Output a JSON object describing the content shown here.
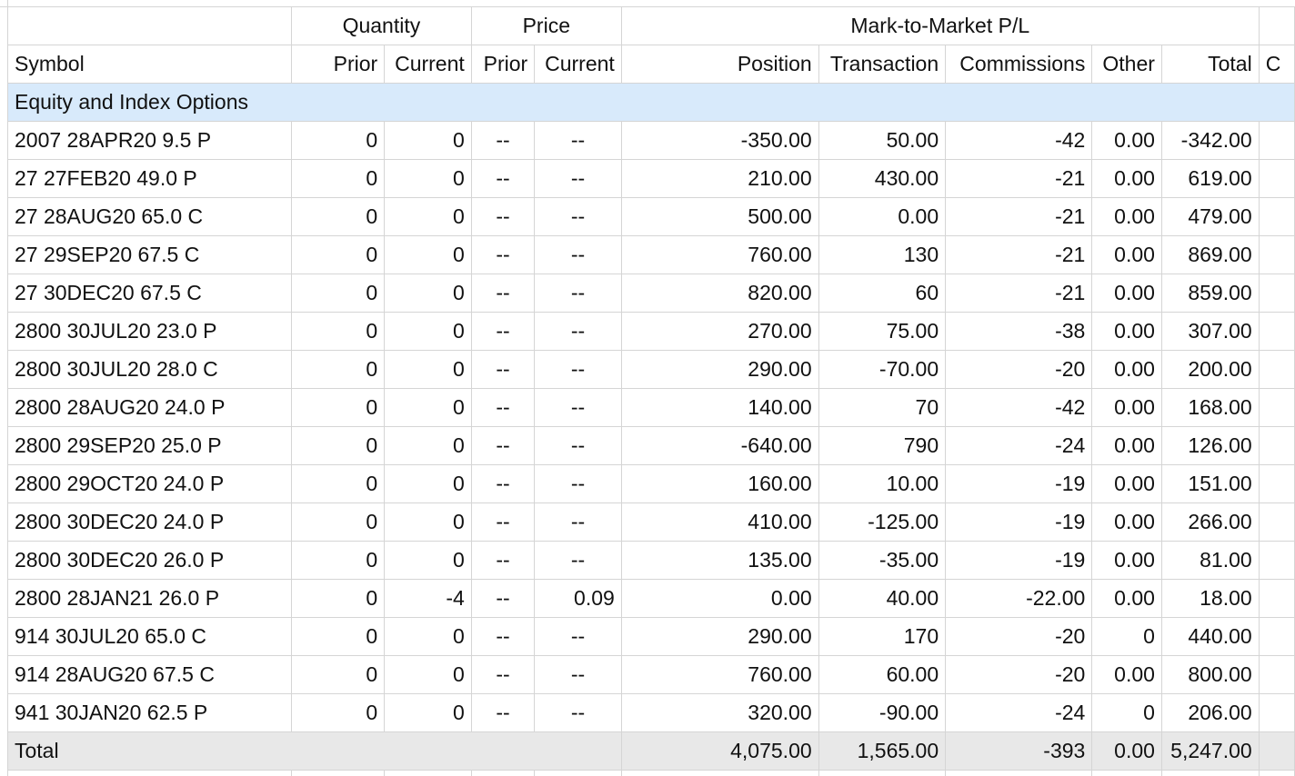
{
  "header": {
    "groups": {
      "quantity": "Quantity",
      "price": "Price",
      "mtm": "Mark-to-Market P/L"
    },
    "columns": {
      "symbol": "Symbol",
      "qty_prior": "Prior",
      "qty_current": "Current",
      "price_prior": "Prior",
      "price_current": "Current",
      "position": "Position",
      "transaction": "Transaction",
      "commissions": "Commissions",
      "other": "Other",
      "total": "Total",
      "overflow": "C"
    }
  },
  "section": {
    "title": "Equity and Index Options"
  },
  "rows": [
    {
      "symbol": "2007 28APR20 9.5 P",
      "qty_prior": "0",
      "qty_current": "0",
      "price_prior": "--",
      "price_current": "--",
      "position": "-350.00",
      "transaction": "50.00",
      "commissions": "-42",
      "other": "0.00",
      "total": "-342.00"
    },
    {
      "symbol": "27 27FEB20 49.0 P",
      "qty_prior": "0",
      "qty_current": "0",
      "price_prior": "--",
      "price_current": "--",
      "position": "210.00",
      "transaction": "430.00",
      "commissions": "-21",
      "other": "0.00",
      "total": "619.00"
    },
    {
      "symbol": "27 28AUG20 65.0 C",
      "qty_prior": "0",
      "qty_current": "0",
      "price_prior": "--",
      "price_current": "--",
      "position": "500.00",
      "transaction": "0.00",
      "commissions": "-21",
      "other": "0.00",
      "total": "479.00"
    },
    {
      "symbol": "27 29SEP20 67.5 C",
      "qty_prior": "0",
      "qty_current": "0",
      "price_prior": "--",
      "price_current": "--",
      "position": "760.00",
      "transaction": "130",
      "commissions": "-21",
      "other": "0.00",
      "total": "869.00"
    },
    {
      "symbol": "27 30DEC20 67.5 C",
      "qty_prior": "0",
      "qty_current": "0",
      "price_prior": "--",
      "price_current": "--",
      "position": "820.00",
      "transaction": "60",
      "commissions": "-21",
      "other": "0.00",
      "total": "859.00"
    },
    {
      "symbol": "2800 30JUL20 23.0 P",
      "qty_prior": "0",
      "qty_current": "0",
      "price_prior": "--",
      "price_current": "--",
      "position": "270.00",
      "transaction": "75.00",
      "commissions": "-38",
      "other": "0.00",
      "total": "307.00"
    },
    {
      "symbol": "2800 30JUL20 28.0 C",
      "qty_prior": "0",
      "qty_current": "0",
      "price_prior": "--",
      "price_current": "--",
      "position": "290.00",
      "transaction": "-70.00",
      "commissions": "-20",
      "other": "0.00",
      "total": "200.00"
    },
    {
      "symbol": "2800 28AUG20 24.0 P",
      "qty_prior": "0",
      "qty_current": "0",
      "price_prior": "--",
      "price_current": "--",
      "position": "140.00",
      "transaction": "70",
      "commissions": "-42",
      "other": "0.00",
      "total": "168.00"
    },
    {
      "symbol": "2800 29SEP20 25.0 P",
      "qty_prior": "0",
      "qty_current": "0",
      "price_prior": "--",
      "price_current": "--",
      "position": "-640.00",
      "transaction": "790",
      "commissions": "-24",
      "other": "0.00",
      "total": "126.00"
    },
    {
      "symbol": "2800 29OCT20 24.0 P",
      "qty_prior": "0",
      "qty_current": "0",
      "price_prior": "--",
      "price_current": "--",
      "position": "160.00",
      "transaction": "10.00",
      "commissions": "-19",
      "other": "0.00",
      "total": "151.00"
    },
    {
      "symbol": "2800 30DEC20 24.0 P",
      "qty_prior": "0",
      "qty_current": "0",
      "price_prior": "--",
      "price_current": "--",
      "position": "410.00",
      "transaction": "-125.00",
      "commissions": "-19",
      "other": "0.00",
      "total": "266.00"
    },
    {
      "symbol": "2800 30DEC20 26.0 P",
      "qty_prior": "0",
      "qty_current": "0",
      "price_prior": "--",
      "price_current": "--",
      "position": "135.00",
      "transaction": "-35.00",
      "commissions": "-19",
      "other": "0.00",
      "total": "81.00"
    },
    {
      "symbol": "2800 28JAN21 26.0 P",
      "qty_prior": "0",
      "qty_current": "-4",
      "price_prior": "--",
      "price_current": "0.09",
      "position": "0.00",
      "transaction": "40.00",
      "commissions": "-22.00",
      "other": "0.00",
      "total": "18.00"
    },
    {
      "symbol": "914 30JUL20 65.0 C",
      "qty_prior": "0",
      "qty_current": "0",
      "price_prior": "--",
      "price_current": "--",
      "position": "290.00",
      "transaction": "170",
      "commissions": "-20",
      "other": "0",
      "total": "440.00"
    },
    {
      "symbol": "914 28AUG20 67.5 C",
      "qty_prior": "0",
      "qty_current": "0",
      "price_prior": "--",
      "price_current": "--",
      "position": "760.00",
      "transaction": "60.00",
      "commissions": "-20",
      "other": "0.00",
      "total": "800.00"
    },
    {
      "symbol": "941 30JAN20 62.5 P",
      "qty_prior": "0",
      "qty_current": "0",
      "price_prior": "--",
      "price_current": "--",
      "position": "320.00",
      "transaction": "-90.00",
      "commissions": "-24",
      "other": "0",
      "total": "206.00"
    }
  ],
  "totals": {
    "label": "Total",
    "position": "4,075.00",
    "transaction": "1,565.00",
    "commissions": "-393",
    "other": "0.00",
    "total": "5,247.00"
  },
  "colors": {
    "section_bg": "#d8eafb",
    "total_bg": "#e8e8e8",
    "gridline": "#d5d5d5"
  }
}
